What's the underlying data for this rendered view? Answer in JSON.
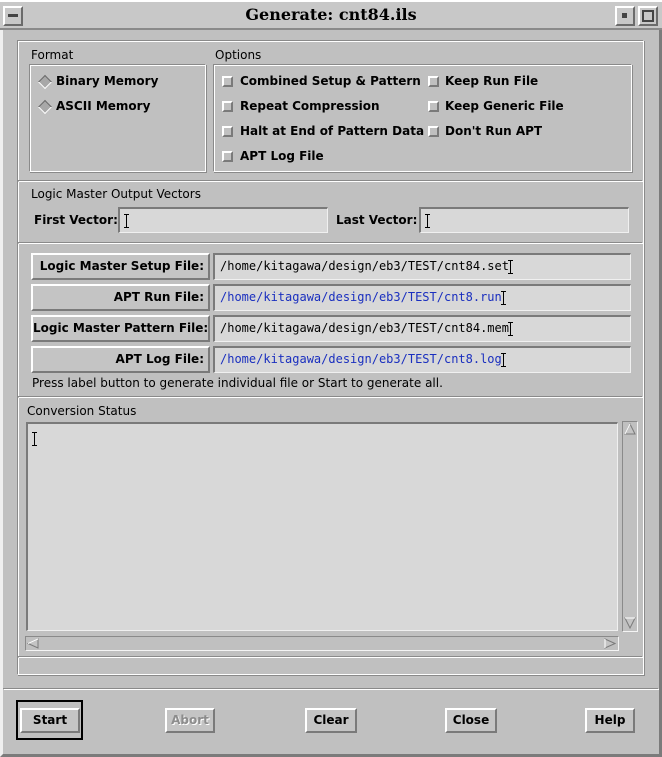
{
  "window": {
    "title": "Generate: cnt84.ils"
  },
  "format": {
    "heading": "Format",
    "options": [
      "Binary Memory",
      "ASCII Memory"
    ]
  },
  "options": {
    "heading": "Options",
    "items": [
      "Combined Setup & Pattern",
      "Repeat Compression",
      "Halt at End of Pattern Data",
      "APT Log File",
      "Keep Run File",
      "Keep Generic File",
      "Don't Run APT"
    ]
  },
  "vectors": {
    "heading": "Logic Master Output Vectors",
    "first_label": "First Vector:",
    "first_value": "",
    "last_label": "Last Vector:",
    "last_value": ""
  },
  "files": {
    "rows": [
      {
        "label": "Logic Master Setup File:",
        "value": "/home/kitagawa/design/eb3/TEST/cnt84.set"
      },
      {
        "label": "APT Run File:",
        "value": "/home/kitagawa/design/eb3/TEST/cnt8.run"
      },
      {
        "label": "Logic Master Pattern File:",
        "value": "/home/kitagawa/design/eb3/TEST/cnt84.mem"
      },
      {
        "label": "APT Log File:",
        "value": "/home/kitagawa/design/eb3/TEST/cnt8.log"
      }
    ],
    "hint": "Press label button to generate individual file or Start to generate all."
  },
  "status": {
    "heading": "Conversion Status",
    "text": ""
  },
  "buttons": {
    "start": "Start",
    "abort": "Abort",
    "clear": "Clear",
    "close": "Close",
    "help": "Help"
  },
  "colors": {
    "background": "#c0c0c0",
    "path_blue": "#1a2fbf"
  },
  "icons": [
    "window-menu-icon",
    "minimize-icon",
    "maximize-icon",
    "radio-icon",
    "checkbox-icon",
    "arrow-up-icon",
    "arrow-down-icon",
    "arrow-left-icon",
    "arrow-right-icon"
  ]
}
